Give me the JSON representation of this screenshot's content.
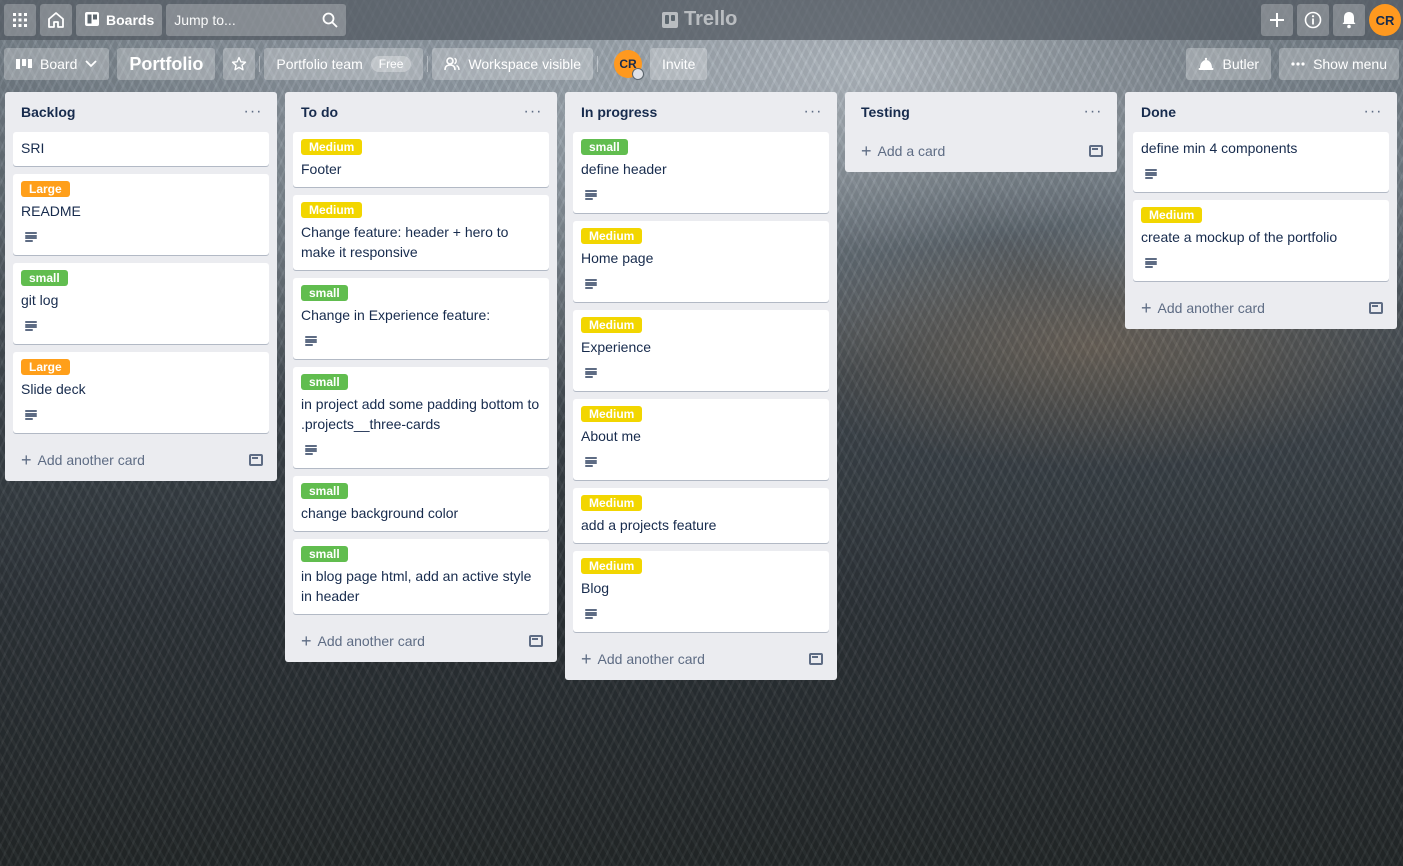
{
  "header": {
    "apps_icon": "apps-grid-icon",
    "home_icon": "home-icon",
    "boards_label": "Boards",
    "search_placeholder": "Jump to...",
    "logo_text": "Trello",
    "user_initials": "CR"
  },
  "board": {
    "view_label": "Board",
    "title": "Portfolio",
    "team_label": "Portfolio team",
    "team_badge": "Free",
    "visibility_label": "Workspace visible",
    "member_initials": "CR",
    "invite_label": "Invite",
    "butler_label": "Butler",
    "show_menu_label": "Show menu"
  },
  "lists": [
    {
      "title": "Backlog",
      "footer": "Add another card",
      "cards": [
        {
          "label": "",
          "label_color": "",
          "title": "SRI",
          "has_desc": false
        },
        {
          "label": "Large",
          "label_color": "orange",
          "title": "README",
          "has_desc": true
        },
        {
          "label": "small",
          "label_color": "green",
          "title": "git log",
          "has_desc": true
        },
        {
          "label": "Large",
          "label_color": "orange",
          "title": "Slide deck",
          "has_desc": true
        }
      ]
    },
    {
      "title": "To do",
      "footer": "Add another card",
      "cards": [
        {
          "label": "Medium",
          "label_color": "yellow",
          "title": "Footer",
          "has_desc": false
        },
        {
          "label": "Medium",
          "label_color": "yellow",
          "title": "Change feature: header + hero to make it responsive",
          "has_desc": false
        },
        {
          "label": "small",
          "label_color": "green",
          "title": "Change in Experience feature:",
          "has_desc": true
        },
        {
          "label": "small",
          "label_color": "green",
          "title": "in project add some padding bottom to .projects__three-cards",
          "has_desc": true
        },
        {
          "label": "small",
          "label_color": "green",
          "title": "change background color",
          "has_desc": false
        },
        {
          "label": "small",
          "label_color": "green",
          "title": "in blog page html, add an active style in header",
          "has_desc": false
        }
      ]
    },
    {
      "title": "In progress",
      "footer": "Add another card",
      "cards": [
        {
          "label": "small",
          "label_color": "green",
          "title": "define header",
          "has_desc": true
        },
        {
          "label": "Medium",
          "label_color": "yellow",
          "title": "Home page",
          "has_desc": true
        },
        {
          "label": "Medium",
          "label_color": "yellow",
          "title": "Experience",
          "has_desc": true
        },
        {
          "label": "Medium",
          "label_color": "yellow",
          "title": "About me",
          "has_desc": true
        },
        {
          "label": "Medium",
          "label_color": "yellow",
          "title": "add a projects feature",
          "has_desc": false
        },
        {
          "label": "Medium",
          "label_color": "yellow",
          "title": "Blog",
          "has_desc": true
        }
      ]
    },
    {
      "title": "Testing",
      "footer": "Add a card",
      "cards": []
    },
    {
      "title": "Done",
      "footer": "Add another card",
      "cards": [
        {
          "label": "",
          "label_color": "",
          "title": "define min 4 components",
          "has_desc": true
        },
        {
          "label": "Medium",
          "label_color": "yellow",
          "title": "create a mockup of the portfolio",
          "has_desc": true
        }
      ]
    }
  ],
  "colors": {
    "label_yellow": "#f2d600",
    "label_orange": "#ff9f1a",
    "label_green": "#61bd4f",
    "avatar": "#ff991f",
    "list_bg": "#ebecf0"
  }
}
